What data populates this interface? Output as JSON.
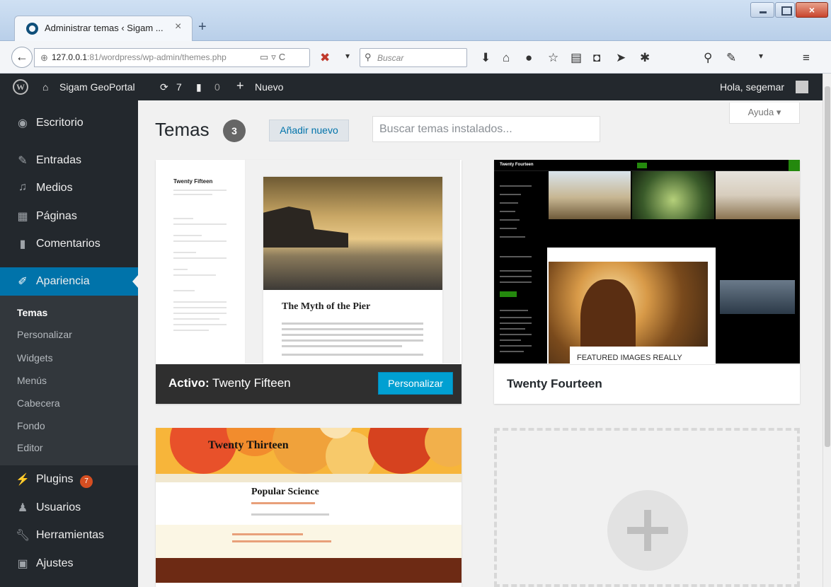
{
  "browser": {
    "tab_title": "Administrar temas ‹ Sigam ...",
    "tab_close": "×",
    "new_tab": "+",
    "url_host": "127.0.0.1",
    "url_rest": ":81/wordpress/wp-admin/themes.php",
    "search_placeholder": "Buscar"
  },
  "adminbar": {
    "site_name": "Sigam GeoPortal",
    "updates_count": "7",
    "comments_count": "0",
    "new_label": "Nuevo",
    "greeting": "Hola, segemar"
  },
  "sidebar": {
    "items": [
      {
        "label": "Escritorio",
        "icon": "dashboard-icon"
      },
      {
        "label": "Entradas",
        "icon": "pin-icon"
      },
      {
        "label": "Medios",
        "icon": "media-icon"
      },
      {
        "label": "Páginas",
        "icon": "pages-icon"
      },
      {
        "label": "Comentarios",
        "icon": "comment-icon"
      },
      {
        "label": "Apariencia",
        "icon": "brush-icon"
      },
      {
        "label": "Plugins",
        "icon": "plugin-icon"
      },
      {
        "label": "Usuarios",
        "icon": "users-icon"
      },
      {
        "label": "Herramientas",
        "icon": "wrench-icon"
      },
      {
        "label": "Ajustes",
        "icon": "settings-icon"
      }
    ],
    "submenu": [
      "Temas",
      "Personalizar",
      "Widgets",
      "Menús",
      "Cabecera",
      "Fondo",
      "Editor"
    ],
    "plugins_badge": "7"
  },
  "main": {
    "help_label": "Ayuda",
    "title": "Temas",
    "theme_count": "3",
    "add_new_label": "Añadir nuevo",
    "search_placeholder": "Buscar temas instalados...",
    "themes": [
      {
        "name": "Twenty Fifteen",
        "active_prefix": "Activo:",
        "customize_label": "Personalizar",
        "preview_title": "Twenty Fifteen",
        "preview_post_title": "The Myth of the Pier"
      },
      {
        "name": "Twenty Fourteen",
        "preview_title": "Twenty Fourteen",
        "preview_caption": "FEATURED IMAGES REALLY"
      },
      {
        "name": "Twenty Thirteen",
        "preview_title": "Twenty Thirteen",
        "preview_post_title": "Popular Science"
      }
    ]
  },
  "colors": {
    "admin_dark": "#23282d",
    "accent_blue": "#0073aa",
    "button_blue": "#00a0d2",
    "badge_orange": "#d54e21"
  }
}
